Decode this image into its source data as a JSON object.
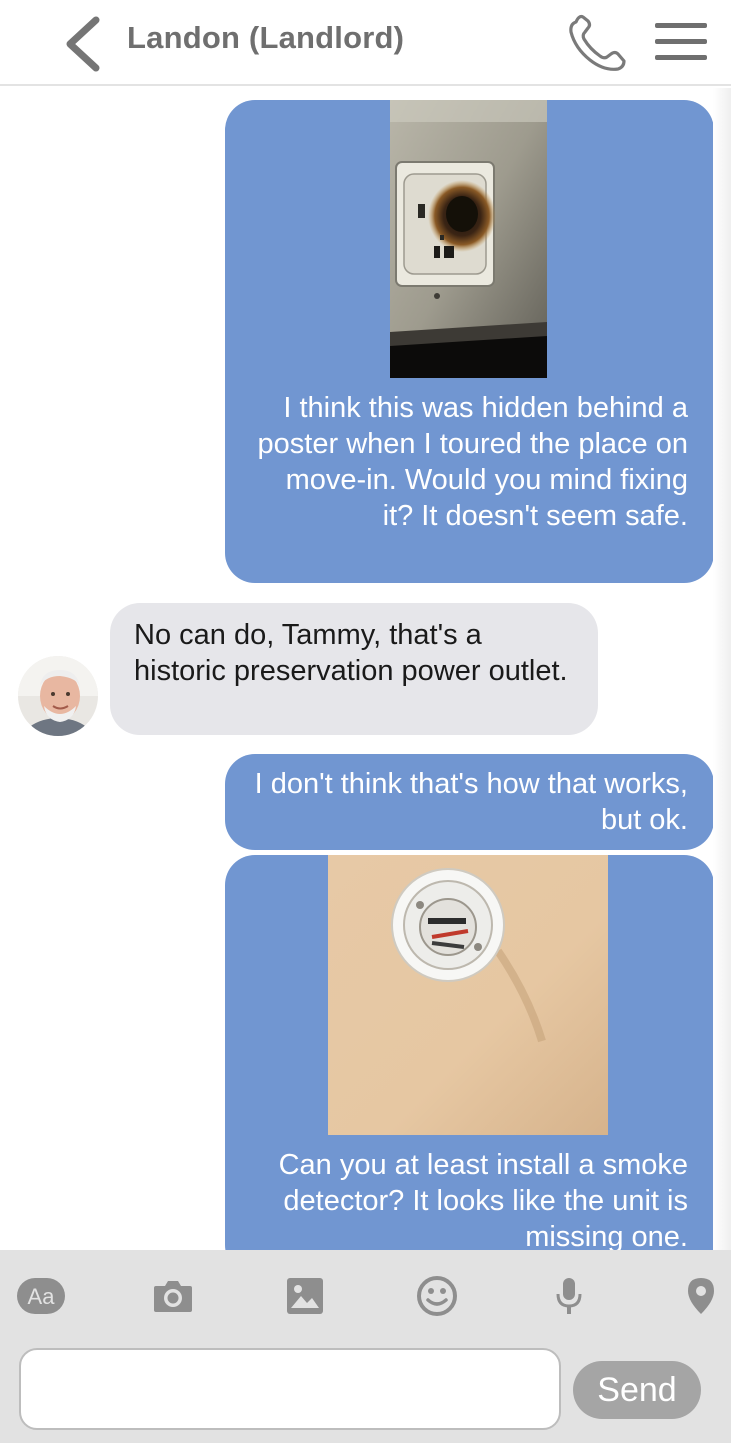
{
  "header": {
    "back_icon": "chevron-left-icon",
    "title": "Landon (Landlord)",
    "call_icon": "phone-icon",
    "menu_icon": "hamburger-menu-icon"
  },
  "messages": [
    {
      "direction": "outgoing",
      "attachment": "photo of burnt power outlet",
      "text": "I think this was hidden behind a poster when I toured the place on move-in. Would you mind fixing it? It doesn't seem safe."
    },
    {
      "direction": "incoming",
      "text": "No can do, Tammy, that's a historic preservation power outlet."
    },
    {
      "direction": "outgoing",
      "text": "I don't think that's how that works, but ok."
    },
    {
      "direction": "outgoing",
      "attachment": "photo of ceiling smoke detector base with missing unit",
      "text": "Can you at least install a smoke detector? It looks like the unit is missing one."
    }
  ],
  "toolbar": {
    "font_button_label": "Aa",
    "camera_icon": "camera-icon",
    "gallery_icon": "image-icon",
    "emoji_icon": "smiley-icon",
    "mic_icon": "microphone-icon",
    "location_icon": "location-pin-icon"
  },
  "composer": {
    "input_value": "",
    "send_label": "Send"
  },
  "colors": {
    "outgoing_bubble": "#7196d1",
    "incoming_bubble": "#e6e6ea",
    "toolbar_bg": "#e2e2e2",
    "send_button": "#a5a5a5"
  }
}
